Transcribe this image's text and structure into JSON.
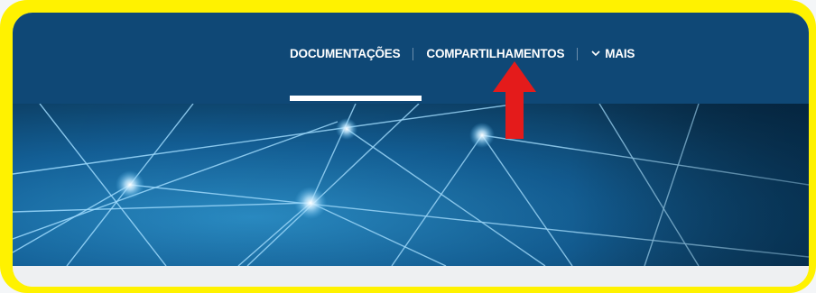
{
  "nav": {
    "items": [
      {
        "label": "DOCUMENTAÇÕES",
        "active": true
      },
      {
        "label": "COMPARTILHAMENTOS",
        "active": false
      },
      {
        "label": "MAIS",
        "icon": "chevron-down-icon",
        "active": false
      }
    ]
  },
  "colors": {
    "highlight_frame": "#fff200",
    "navbar": "#0f4876",
    "arrow": "#e41b1b"
  }
}
